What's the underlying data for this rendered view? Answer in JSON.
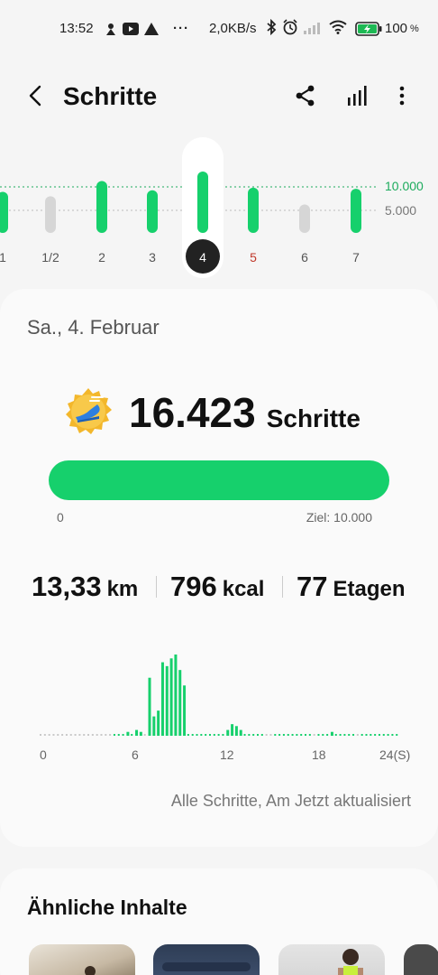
{
  "status_bar": {
    "time": "13:52",
    "network_rate": "2,0KB/s",
    "battery": "100",
    "battery_unit": "%",
    "more": "···"
  },
  "header": {
    "title": "Schritte",
    "icons": [
      "back-arrow-icon",
      "share-icon",
      "stats-icon",
      "more-vert-icon"
    ]
  },
  "week": {
    "days": [
      {
        "label": "1",
        "steps": 11000,
        "weekend": false,
        "met_goal": true
      },
      {
        "label": "1/2",
        "steps": 9800,
        "weekend": false,
        "met_goal": false
      },
      {
        "label": "2",
        "steps": 13900,
        "weekend": false,
        "met_goal": true
      },
      {
        "label": "3",
        "steps": 11400,
        "weekend": false,
        "met_goal": true
      },
      {
        "label": "4",
        "steps": 16423,
        "weekend": false,
        "met_goal": true,
        "selected": true
      },
      {
        "label": "5",
        "steps": 12100,
        "weekend": true,
        "met_goal": true
      },
      {
        "label": "6",
        "steps": 7600,
        "weekend": false,
        "met_goal": false
      },
      {
        "label": "7",
        "steps": 11800,
        "weekend": false,
        "met_goal": true
      }
    ],
    "goal_labels": [
      "10.000",
      "5.000"
    ]
  },
  "summary": {
    "date": "Sa., 4. Februar",
    "steps_value": "16.423",
    "steps_unit": "Schritte",
    "progress": 1.0,
    "bar_start": "0",
    "bar_goal": "Ziel: 10.000",
    "distance_value": "13,33",
    "distance_unit": "km",
    "energy_value": "796",
    "energy_unit": "kcal",
    "floors_value": "77",
    "floors_unit": "Etagen",
    "hour_labels": [
      "0",
      "6",
      "12",
      "18",
      "24(S)"
    ],
    "updated": "Alle Schritte, Am Jetzt aktualisiert"
  },
  "chart_data": {
    "type": "bar",
    "title": "",
    "xlabel": "",
    "ylabel": "",
    "values": [
      0,
      0,
      0,
      0,
      0,
      0,
      0,
      0,
      0,
      0,
      0,
      0,
      0,
      0,
      0,
      0,
      0,
      1,
      1,
      1,
      2,
      1,
      3,
      2,
      0,
      30,
      10,
      13,
      38,
      36,
      40,
      42,
      34,
      26,
      1,
      1,
      1,
      1,
      1,
      1,
      1,
      1,
      1,
      3,
      6,
      5,
      3,
      1,
      1,
      1,
      1,
      1,
      0,
      0,
      1,
      1,
      1,
      1,
      1,
      1,
      1,
      1,
      1,
      0,
      1,
      1,
      1,
      2,
      1,
      1,
      1,
      1,
      1,
      0,
      1,
      1,
      1,
      1,
      1,
      1,
      1,
      1,
      1
    ],
    "colors": {
      "bar": "#16d06c",
      "dot": "#c9c9c9"
    }
  },
  "similar": {
    "title": "Ähnliche Inhalte"
  },
  "colors": {
    "accent": "#16d06c",
    "inactive": "#d6d6d6",
    "weekend": "#c0392b",
    "goal_line": "#1dab5d"
  }
}
